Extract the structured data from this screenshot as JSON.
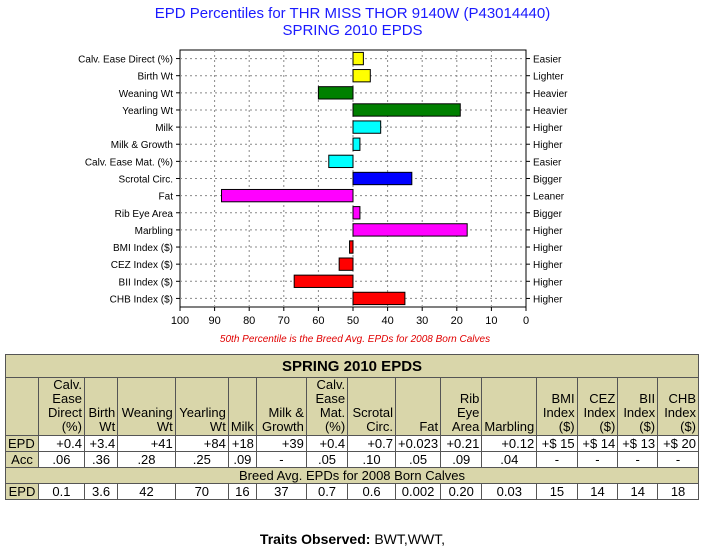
{
  "title_line1": "EPD Percentiles for THR MISS THOR 9140W (P43014440)",
  "title_line2": "SPRING 2010 EPDS",
  "note": "50th Percentile is the Breed Avg. EPDs for 2008 Born Calves",
  "chart_data": {
    "type": "bar",
    "orientation": "horizontal",
    "xlim": [
      100,
      0
    ],
    "xticks": [
      "100",
      "90",
      "80",
      "70",
      "60",
      "50",
      "40",
      "30",
      "20",
      "10",
      "0"
    ],
    "baseline": 50,
    "grid": true,
    "categories": [
      "Calv. Ease Direct (%)",
      "Birth Wt",
      "Weaning Wt",
      "Yearling Wt",
      "Milk",
      "Milk & Growth",
      "Calv. Ease Mat. (%)",
      "Scrotal Circ.",
      "Fat",
      "Rib Eye Area",
      "Marbling",
      "BMI Index ($)",
      "CEZ Index ($)",
      "BII Index ($)",
      "CHB Index ($)"
    ],
    "right_labels": [
      "Easier",
      "Lighter",
      "Heavier",
      "Heavier",
      "Higher",
      "Higher",
      "Easier",
      "Bigger",
      "Leaner",
      "Bigger",
      "Higher",
      "Higher",
      "Higher",
      "Higher",
      "Higher"
    ],
    "values": [
      47,
      45,
      60,
      19,
      42,
      48,
      57,
      33,
      88,
      48,
      17,
      51,
      54,
      67,
      35
    ],
    "colors": [
      "#ffff00",
      "#ffff00",
      "#008000",
      "#008000",
      "#00ffff",
      "#00ffff",
      "#00ffff",
      "#0000ff",
      "#ff00ff",
      "#ff00ff",
      "#ff00ff",
      "#ff0000",
      "#ff0000",
      "#ff0000",
      "#ff0000"
    ]
  },
  "table": {
    "title": "SPRING 2010 EPDS",
    "headers": [
      "Calv. Ease Direct (%)",
      "Birth Wt",
      "Weaning Wt",
      "Yearling Wt",
      "Milk",
      "Milk & Growth",
      "Calv. Ease Mat. (%)",
      "Scrotal Circ.",
      "Fat",
      "Rib Eye Area",
      "Marbling",
      "BMI Index ($)",
      "CEZ Index ($)",
      "BII Index ($)",
      "CHB Index ($)"
    ],
    "epd_label": "EPD",
    "epd": [
      "+0.4",
      "+3.4",
      "+41",
      "+84",
      "+18",
      "+39",
      "+0.4",
      "+0.7",
      "+0.023",
      "+0.21",
      "+0.12",
      "+$ 15",
      "+$ 14",
      "+$ 13",
      "+$ 20"
    ],
    "acc_label": "Acc",
    "acc": [
      ".06",
      ".36",
      ".28",
      ".25",
      ".09",
      "-",
      ".05",
      ".10",
      ".05",
      ".09",
      ".04",
      "-",
      "-",
      "-",
      "-"
    ],
    "breed_title": "Breed Avg. EPDs for 2008 Born Calves",
    "breed_label": "EPD",
    "breed": [
      "0.1",
      "3.6",
      "42",
      "70",
      "16",
      "37",
      "0.7",
      "0.6",
      "0.002",
      "0.20",
      "0.03",
      "15",
      "14",
      "14",
      "18"
    ]
  },
  "observed_label": "Traits Observed:",
  "observed_value": "BWT,WWT,"
}
